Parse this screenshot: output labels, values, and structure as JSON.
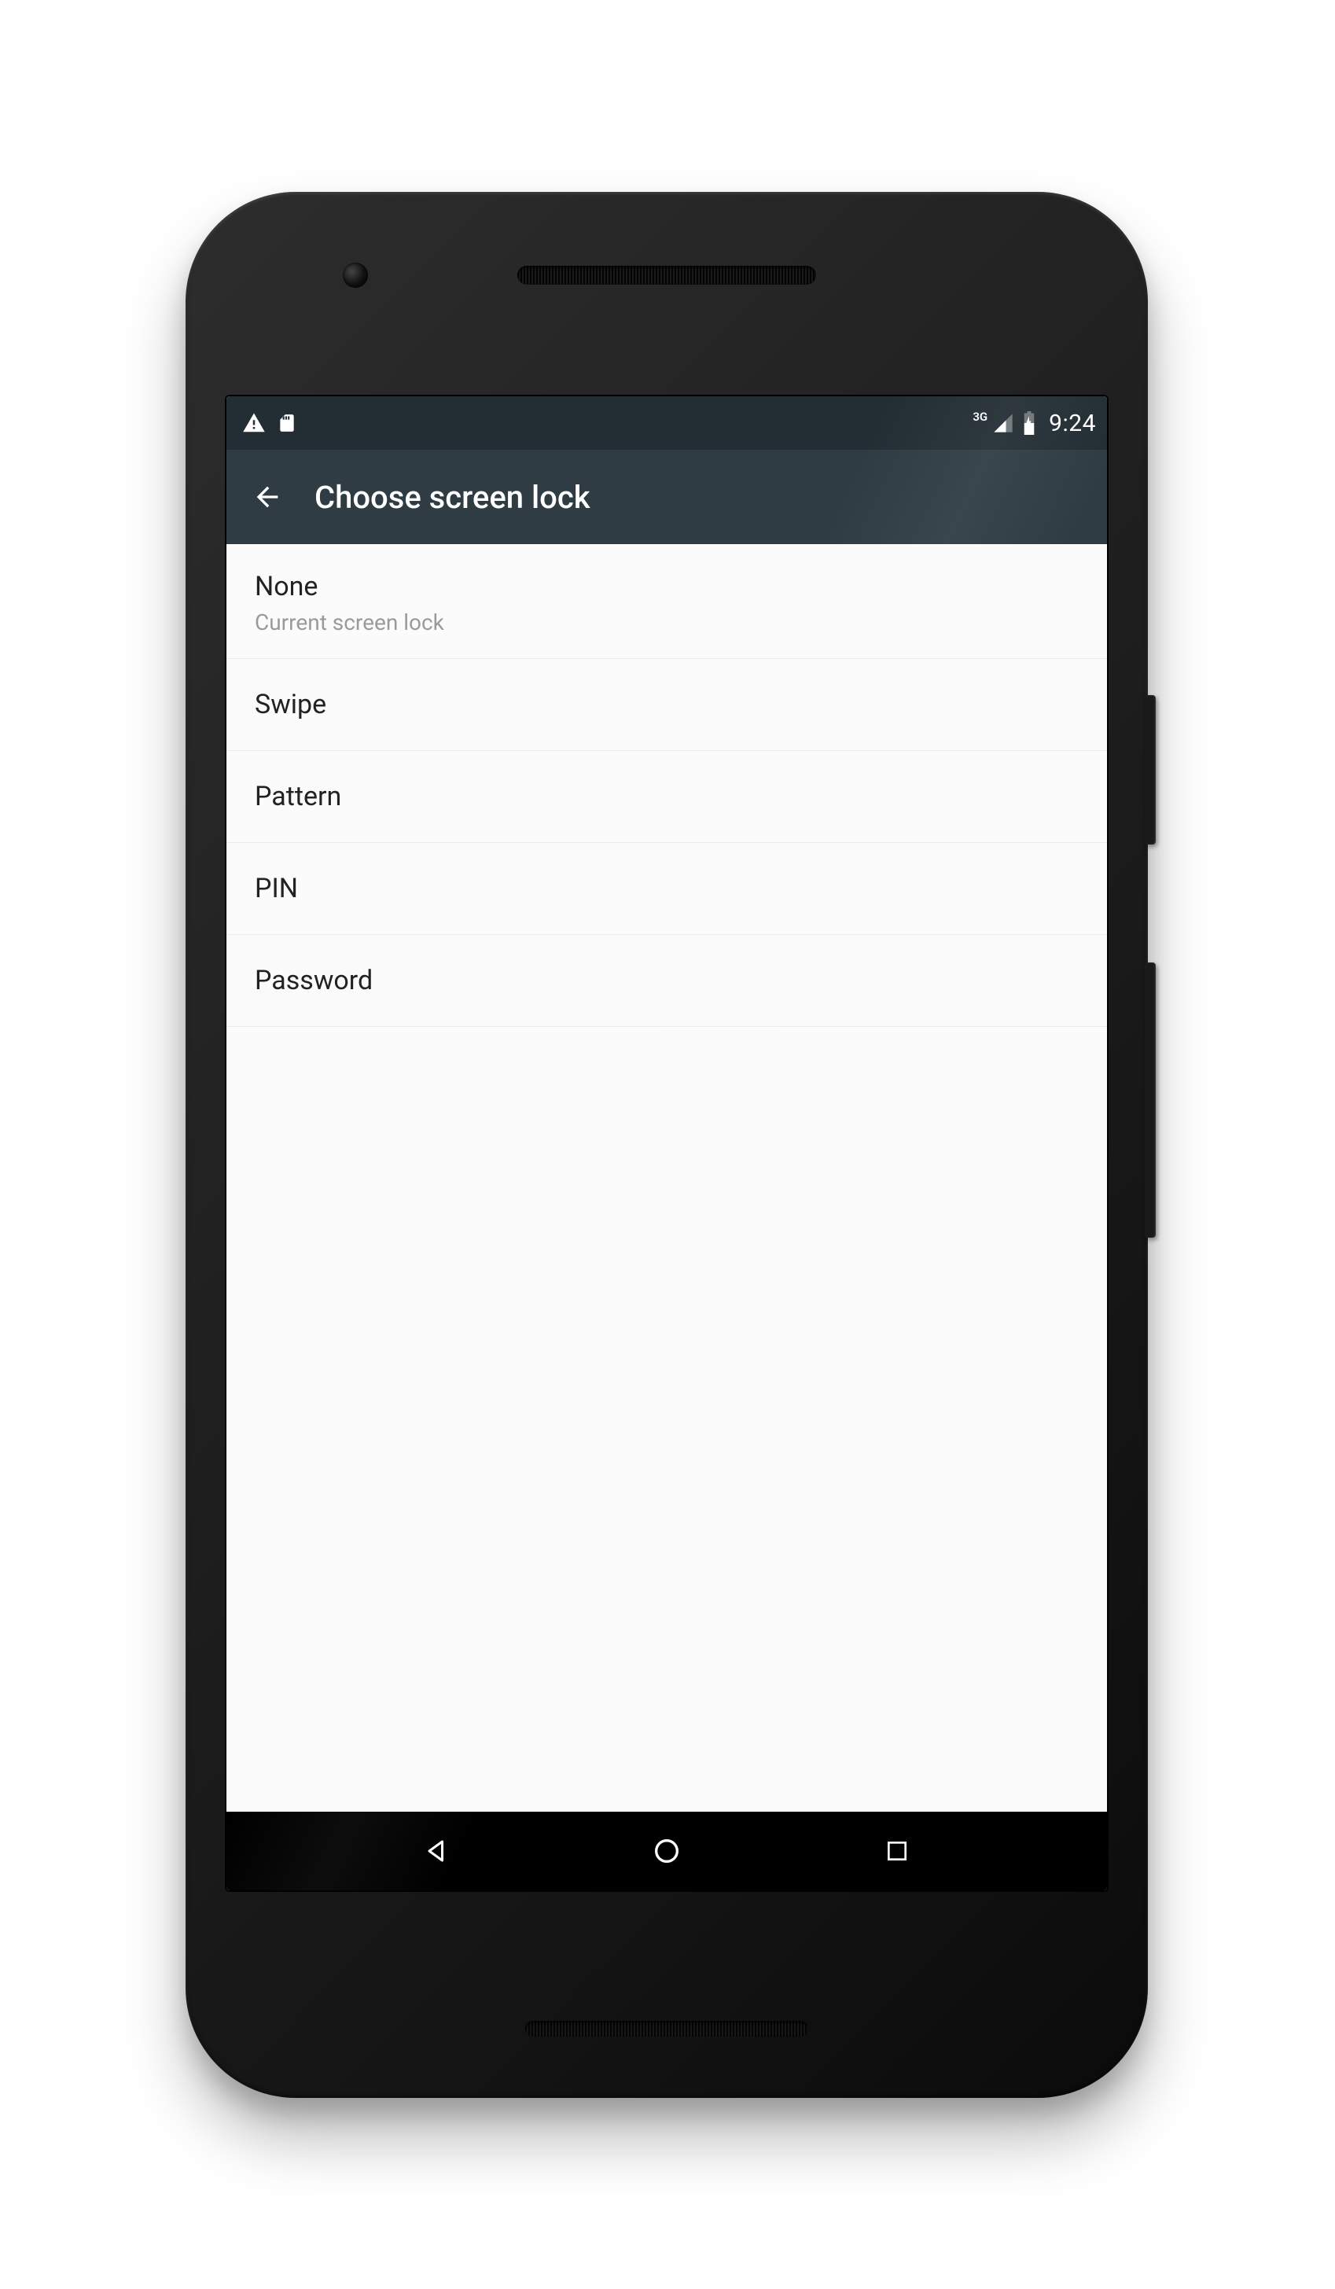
{
  "statusbar": {
    "network_label": "3G",
    "clock": "9:24"
  },
  "appbar": {
    "title": "Choose screen lock"
  },
  "options": [
    {
      "title": "None",
      "subtitle": "Current screen lock"
    },
    {
      "title": "Swipe",
      "subtitle": ""
    },
    {
      "title": "Pattern",
      "subtitle": ""
    },
    {
      "title": "PIN",
      "subtitle": ""
    },
    {
      "title": "Password",
      "subtitle": ""
    }
  ]
}
